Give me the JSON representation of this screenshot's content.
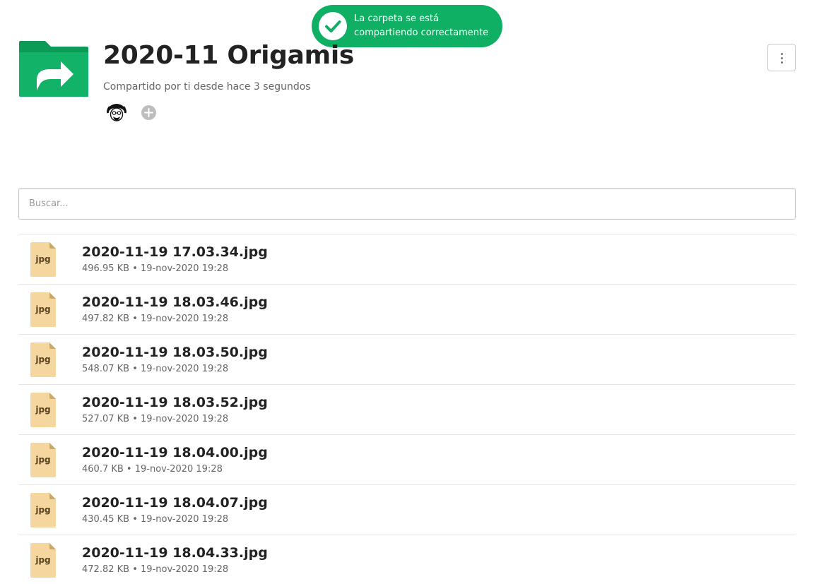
{
  "toast": {
    "line1": "La carpeta se está",
    "line2": "compartiendo correctamente"
  },
  "header": {
    "title": "2020-11 Origamis",
    "share_status": "Compartido por ti desde hace 3 segundos",
    "folder_icon": "shared-folder-icon",
    "more_icon": "more-vertical-icon",
    "add_icon": "plus-circle-icon"
  },
  "search": {
    "placeholder": "Buscar..."
  },
  "files": [
    {
      "name": "2020-11-19 17.03.34.jpg",
      "size": "496.95 KB",
      "date": "19-nov-2020 19:28",
      "type": "jpg"
    },
    {
      "name": "2020-11-19 18.03.46.jpg",
      "size": "497.82 KB",
      "date": "19-nov-2020 19:28",
      "type": "jpg"
    },
    {
      "name": "2020-11-19 18.03.50.jpg",
      "size": "548.07 KB",
      "date": "19-nov-2020 19:28",
      "type": "jpg"
    },
    {
      "name": "2020-11-19 18.03.52.jpg",
      "size": "527.07 KB",
      "date": "19-nov-2020 19:28",
      "type": "jpg"
    },
    {
      "name": "2020-11-19 18.04.00.jpg",
      "size": "460.7 KB",
      "date": "19-nov-2020 19:28",
      "type": "jpg"
    },
    {
      "name": "2020-11-19 18.04.07.jpg",
      "size": "430.45 KB",
      "date": "19-nov-2020 19:28",
      "type": "jpg"
    },
    {
      "name": "2020-11-19 18.04.33.jpg",
      "size": "472.82 KB",
      "date": "19-nov-2020 19:28",
      "type": "jpg"
    }
  ],
  "colors": {
    "accent": "#10b064",
    "file_icon": "#f5d69e"
  }
}
